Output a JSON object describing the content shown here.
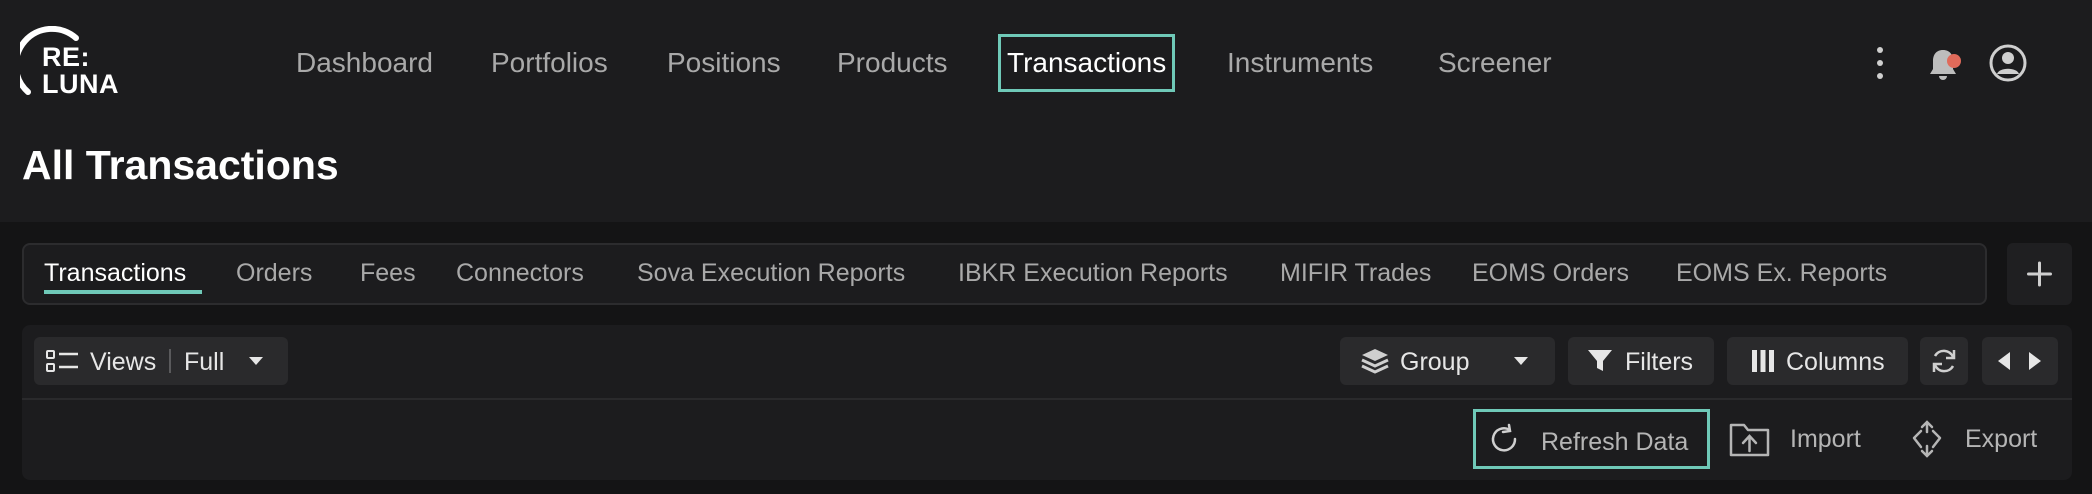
{
  "brand": {
    "logo_line1": "RE:",
    "logo_line2": "LUNA"
  },
  "nav": {
    "items": [
      {
        "label": "Dashboard"
      },
      {
        "label": "Portfolios"
      },
      {
        "label": "Positions"
      },
      {
        "label": "Products"
      },
      {
        "label": "Transactions",
        "active": true
      },
      {
        "label": "Instruments"
      },
      {
        "label": "Screener"
      }
    ]
  },
  "header_icons": [
    "more-vertical-icon",
    "bell-icon",
    "user-icon"
  ],
  "page": {
    "title": "All Transactions"
  },
  "subtabs": [
    {
      "label": "Transactions",
      "active": true
    },
    {
      "label": "Orders"
    },
    {
      "label": "Fees"
    },
    {
      "label": "Connectors"
    },
    {
      "label": "Sova Execution Reports"
    },
    {
      "label": "IBKR Execution Reports"
    },
    {
      "label": "MIFIR Trades"
    },
    {
      "label": "EOMS Orders"
    },
    {
      "label": "EOMS Ex. Reports"
    }
  ],
  "toolbar": {
    "views_label": "Views",
    "views_value": "Full",
    "group_label": "Group",
    "filters_label": "Filters",
    "columns_label": "Columns"
  },
  "actions": {
    "refresh_label": "Refresh Data",
    "import_label": "Import",
    "export_label": "Export"
  },
  "colors": {
    "accent": "#6fc9b8",
    "notification_dot": "#e06a5a",
    "background": "#1c1c1e"
  }
}
